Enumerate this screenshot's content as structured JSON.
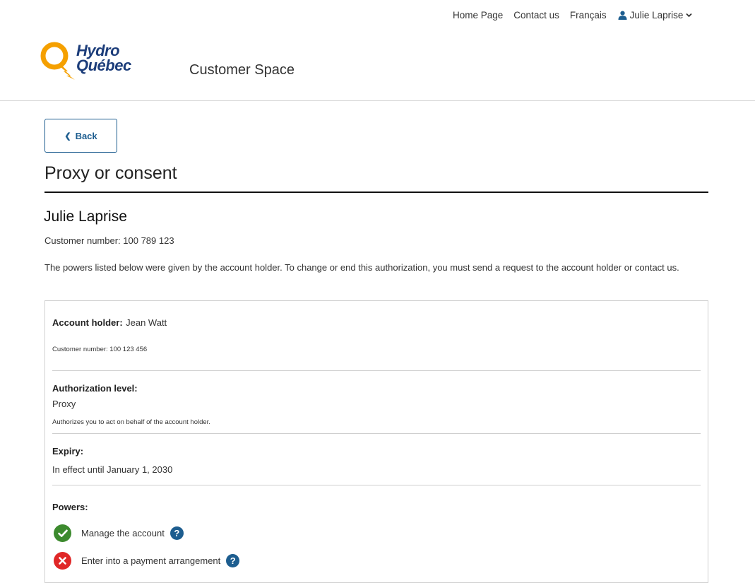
{
  "top_nav": {
    "home": "Home Page",
    "contact": "Contact us",
    "language": "Français",
    "user_name": "Julie Laprise"
  },
  "header": {
    "logo_line1": "Hydro",
    "logo_line2": "Québec",
    "section": "Customer Space"
  },
  "back_label": "Back",
  "page_title": "Proxy or consent",
  "holder_name": "Julie Laprise",
  "customer_number": "Customer number: 100 789 123",
  "intro": "The powers listed below were given by the account holder. To change or end this authorization, you must send a request to the account holder or contact us.",
  "card": {
    "account_holder_label": "Account holder:",
    "account_holder_value": "Jean Watt",
    "account_customer_number": "Customer number: 100 123 456",
    "auth_label": "Authorization level:",
    "auth_value": "Proxy",
    "auth_desc": "Authorizes you to act on behalf of the account holder.",
    "expiry_label": "Expiry:",
    "expiry_value": "In effect until January 1, 2030",
    "powers_label": "Powers:",
    "powers": [
      {
        "label": "Manage the account",
        "granted": true
      },
      {
        "label": "Enter into a payment arrangement",
        "granted": false
      }
    ],
    "help_glyph": "?"
  },
  "colors": {
    "brand_blue": "#1c3d7a",
    "brand_orange": "#f5a000",
    "link_blue": "#1d5d8f",
    "granted_green": "#3c8a2e",
    "denied_red": "#e02727"
  },
  "icons": {
    "user": "user-icon",
    "chevron": "chevron-down-icon",
    "back": "chevron-left-icon",
    "granted": "check-icon",
    "denied": "x-icon",
    "help": "help-icon"
  }
}
